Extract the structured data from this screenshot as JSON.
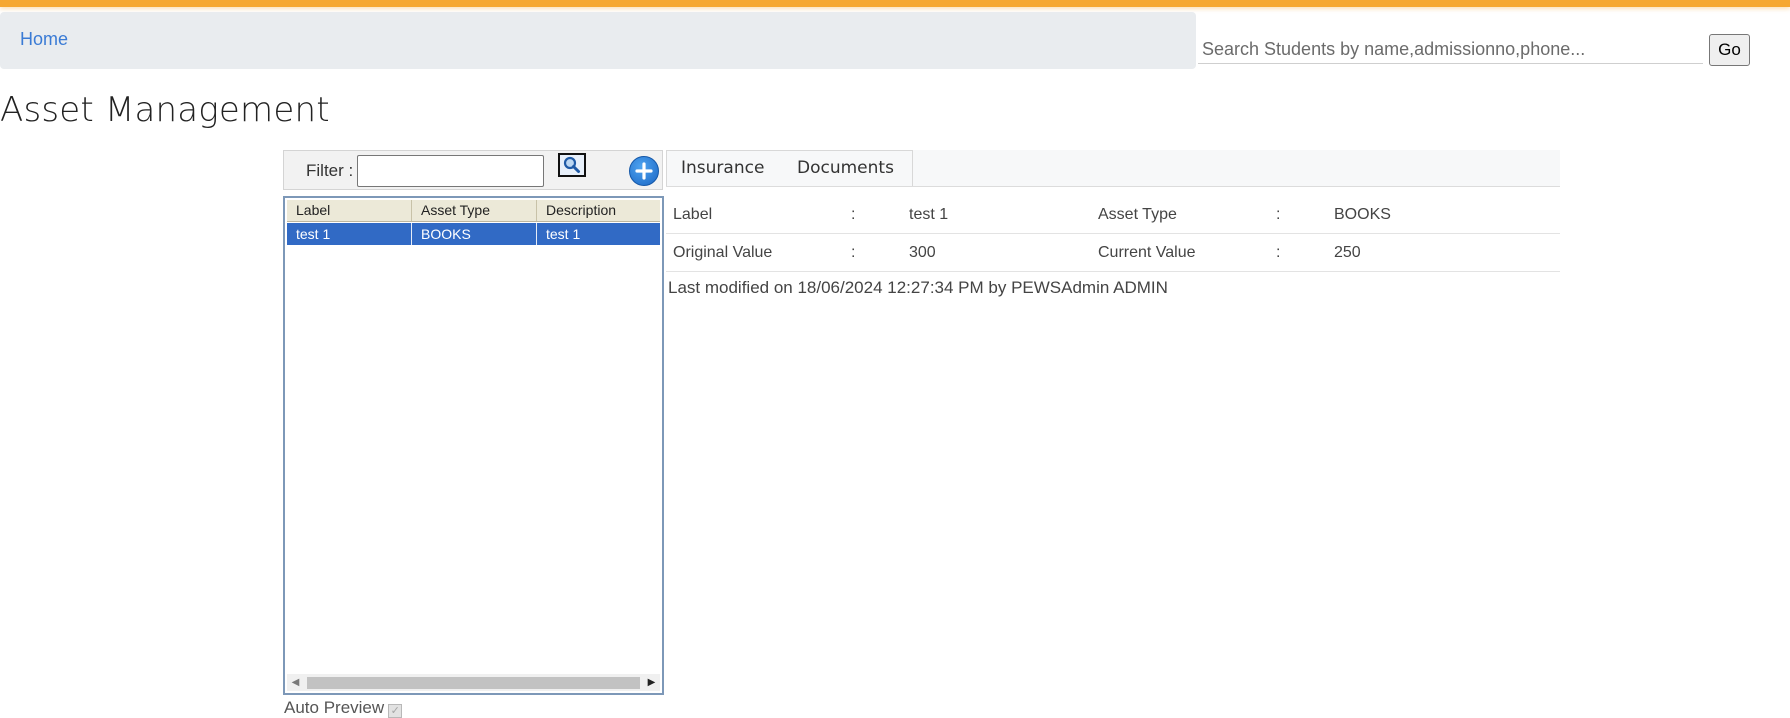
{
  "breadcrumb": {
    "home": "Home"
  },
  "search": {
    "placeholder": "Search Students by name,admissionno,phone...",
    "value": "",
    "go_label": "Go"
  },
  "page": {
    "title": "Asset Management"
  },
  "filter": {
    "label": "Filter :",
    "value": ""
  },
  "grid": {
    "columns": [
      "Label",
      "Asset Type",
      "Description"
    ],
    "rows": [
      {
        "label": "test 1",
        "asset_type": "BOOKS",
        "description": "test 1",
        "selected": true
      }
    ]
  },
  "auto_preview": {
    "label": "Auto Preview",
    "checked": true
  },
  "tabs": [
    "Insurance",
    "Documents"
  ],
  "details": {
    "rows": [
      {
        "label1": "Label",
        "sep1": ":",
        "value1": "test 1",
        "label2": "Asset Type",
        "sep2": ":",
        "value2": "BOOKS"
      },
      {
        "label1": "Original Value",
        "sep1": ":",
        "value1": "300",
        "label2": "Current Value",
        "sep2": ":",
        "value2": "250"
      }
    ],
    "last_modified": "Last modified on 18/06/2024 12:27:34 PM by PEWSAdmin ADMIN"
  },
  "colors": {
    "accent_bar": "#f6a730",
    "link": "#3a7bd5",
    "selection": "#316ac5",
    "grid_header": "#ece9d8",
    "breadcrumb_bg": "#e9ecef"
  },
  "icons": {
    "filter_search": "magnifier-icon",
    "add": "plus-circle-icon",
    "scroll_left": "triangle-left-icon",
    "scroll_right": "triangle-right-icon",
    "checkbox": "check-icon"
  }
}
